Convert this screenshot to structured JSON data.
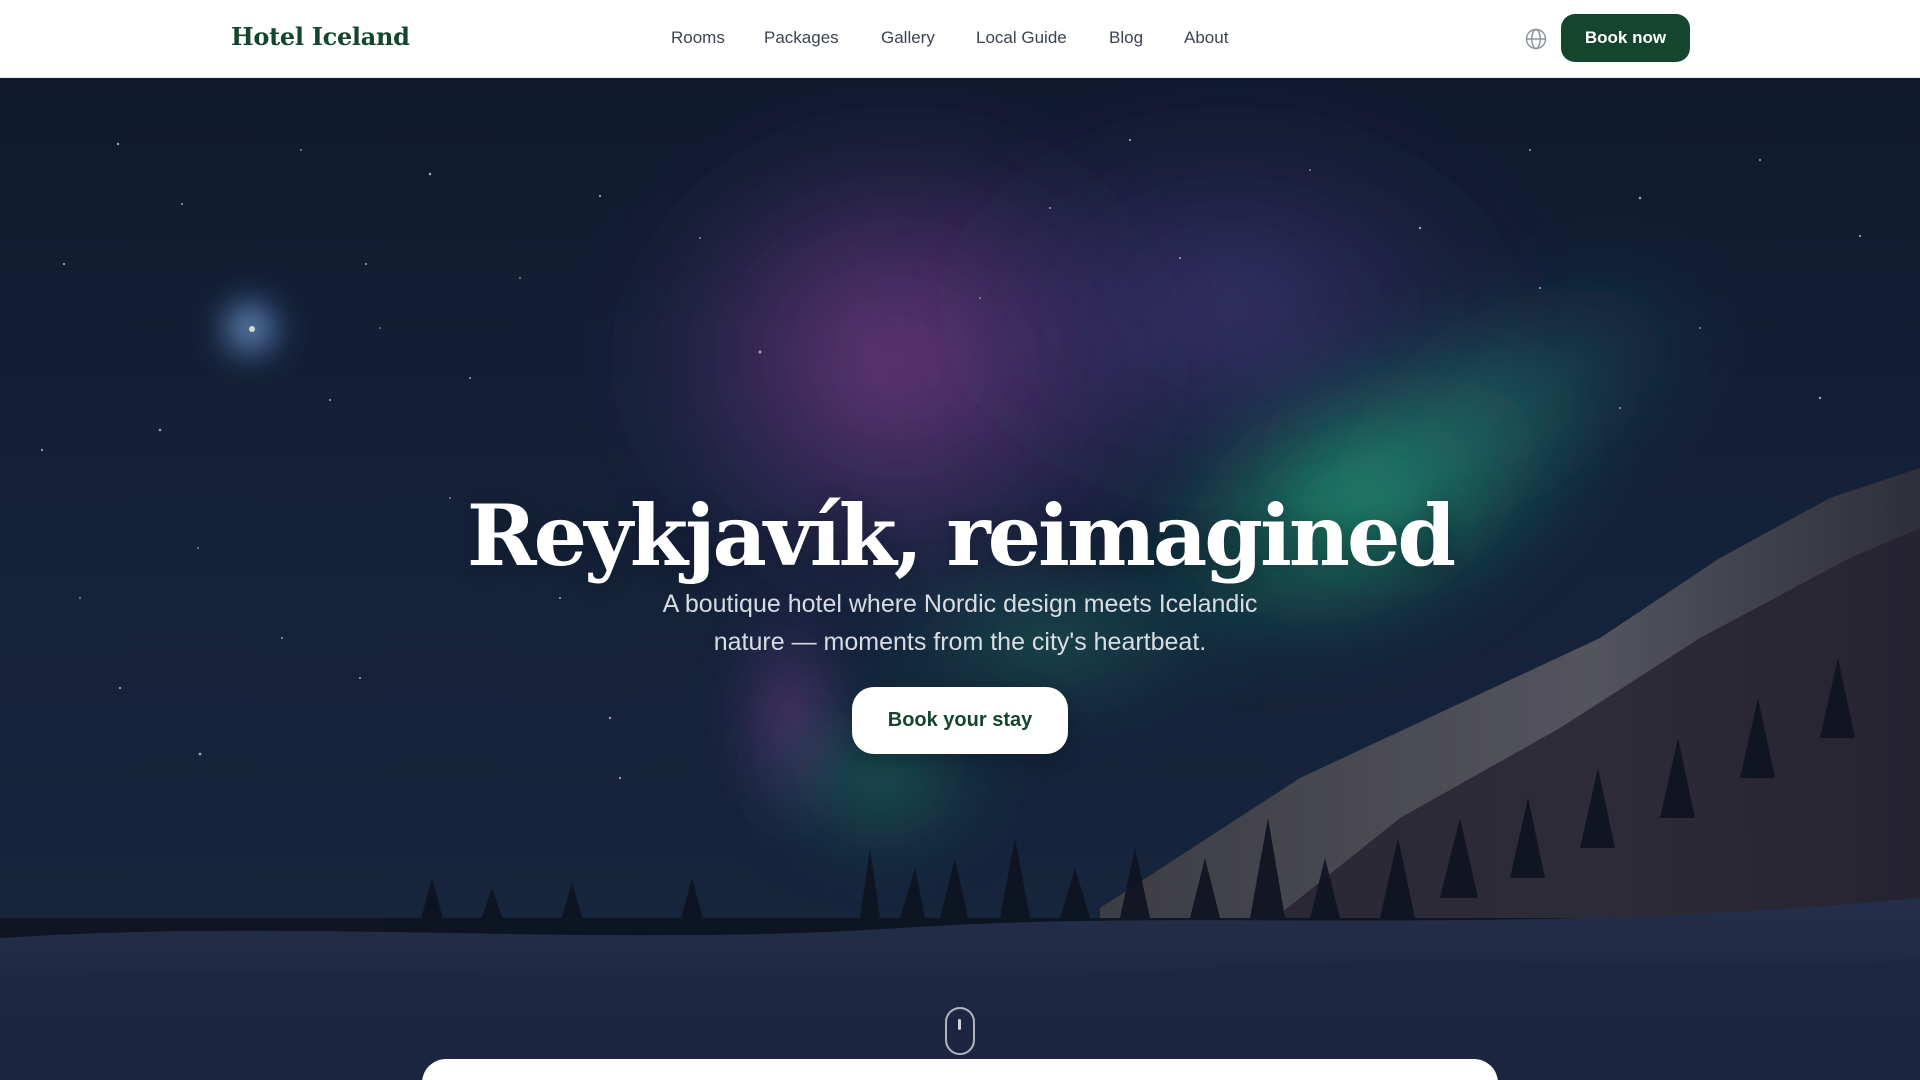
{
  "header": {
    "logo": "Hotel Iceland",
    "nav": [
      "Rooms",
      "Packages",
      "Gallery",
      "Local Guide",
      "Blog",
      "About"
    ],
    "language_icon": "globe-icon",
    "book_now_label": "Book now"
  },
  "hero": {
    "title": "Reykjavík, reimagined",
    "subtitle_lines": [
      "A boutique hotel where Nordic design meets Icelandic",
      "nature — moments from the city's heartbeat."
    ],
    "cta_label": "Book your stay",
    "scroll_icon": "mouse-scroll-icon"
  },
  "colors": {
    "brand": "#14452f",
    "header_bg": "#ffffff",
    "nav_text": "#3b4450",
    "hero_text": "#ffffff",
    "aurora_green": "#2ee59a",
    "aurora_purple": "#a04fb0",
    "night_sky": "#0d1a2e"
  }
}
